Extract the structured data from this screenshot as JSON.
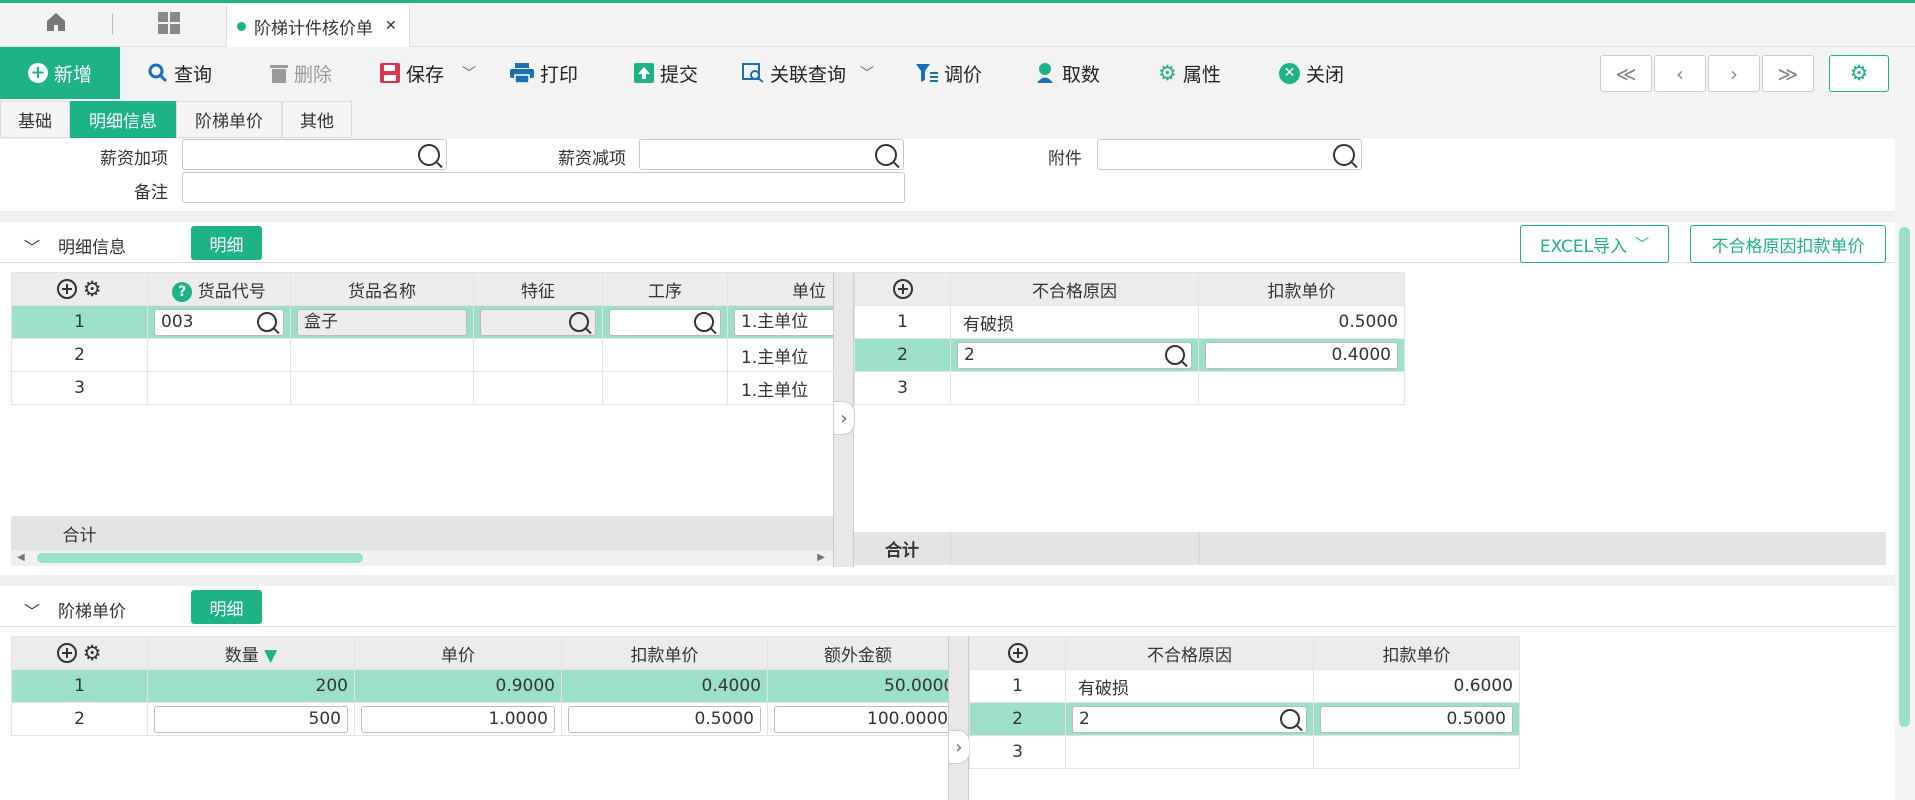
{
  "tabs": {
    "doc_tab": "阶梯计件核价单",
    "close": "✕"
  },
  "toolbar": {
    "new": "新增",
    "query": "查询",
    "delete": "删除",
    "save": "保存",
    "print": "打印",
    "submit": "提交",
    "related_query": "关联查询",
    "adjust_price": "调价",
    "fetch": "取数",
    "properties": "属性",
    "close": "关闭"
  },
  "nav": {
    "first": "≪",
    "prev": "‹",
    "next": "›",
    "last": "≫"
  },
  "subtabs": [
    "基础",
    "明细信息",
    "阶梯单价",
    "其他"
  ],
  "form": {
    "salary_add_label": "薪资加项",
    "salary_add_value": "",
    "salary_sub_label": "薪资减项",
    "salary_sub_value": "",
    "attach_label": "附件",
    "attach_value": "",
    "remark_label": "备注",
    "remark_value": ""
  },
  "detail_section": {
    "title": "明细信息",
    "detail_btn": "明细",
    "excel_btn": "EXCEL导入",
    "reason_btn": "不合格原因扣款单价"
  },
  "detail_table": {
    "headers": [
      "货品代号",
      "货品名称",
      "特征",
      "工序",
      "单位"
    ],
    "rows": [
      {
        "no": "1",
        "code": "003",
        "name": "盒子",
        "feature": "",
        "process": "",
        "unit": "1.主单位"
      },
      {
        "no": "2",
        "code": "",
        "name": "",
        "feature": "",
        "process": "",
        "unit": "1.主单位"
      },
      {
        "no": "3",
        "code": "",
        "name": "",
        "feature": "",
        "process": "",
        "unit": "1.主单位"
      }
    ],
    "total_label": "合计"
  },
  "reason_table1": {
    "headers": [
      "不合格原因",
      "扣款单价"
    ],
    "rows": [
      {
        "no": "1",
        "reason": "有破损",
        "price": "0.5000"
      },
      {
        "no": "2",
        "reason": "2",
        "price": "0.4000"
      },
      {
        "no": "3",
        "reason": "",
        "price": ""
      }
    ],
    "total_label": "合计"
  },
  "step_section": {
    "title": "阶梯单价",
    "detail_btn": "明细"
  },
  "step_table": {
    "headers": [
      "数量",
      "单价",
      "扣款单价",
      "额外金额"
    ],
    "rows": [
      {
        "no": "1",
        "qty": "200",
        "price": "0.9000",
        "deduct": "0.4000",
        "extra": "50.0000"
      },
      {
        "no": "2",
        "qty": "500",
        "price": "1.0000",
        "deduct": "0.5000",
        "extra": "100.0000"
      }
    ]
  },
  "reason_table2": {
    "headers": [
      "不合格原因",
      "扣款单价"
    ],
    "rows": [
      {
        "no": "1",
        "reason": "有破损",
        "price": "0.6000"
      },
      {
        "no": "2",
        "reason": "2",
        "price": "0.5000"
      },
      {
        "no": "3",
        "reason": "",
        "price": ""
      }
    ]
  },
  "colors": {
    "accent": "#1db386",
    "selected_row": "#9de0c8"
  }
}
